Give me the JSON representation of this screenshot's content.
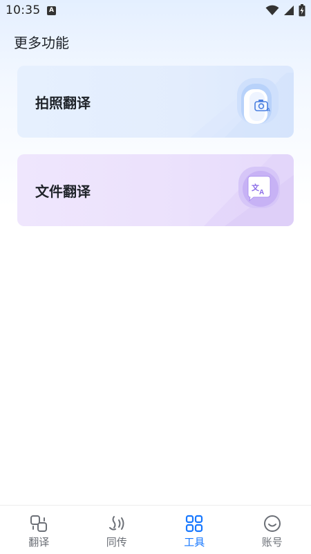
{
  "status_bar": {
    "time": "10:35",
    "notification_glyph": "A",
    "icons": [
      "wifi-icon",
      "cell-signal-icon",
      "battery-charging-icon"
    ]
  },
  "header": {
    "title": "更多功能"
  },
  "cards": [
    {
      "label": "拍照翻译",
      "icon": "camera-translate-icon",
      "color": "#dbe8fd"
    },
    {
      "label": "文件翻译",
      "icon": "document-translate-icon",
      "color": "#e6dafb"
    }
  ],
  "bottom_nav": {
    "items": [
      {
        "label": "翻译",
        "icon": "translate-tab-icon",
        "active": false
      },
      {
        "label": "同传",
        "icon": "interpret-tab-icon",
        "active": false
      },
      {
        "label": "工具",
        "icon": "tools-tab-icon",
        "active": true
      },
      {
        "label": "账号",
        "icon": "account-tab-icon",
        "active": false
      }
    ],
    "active_color": "#1677ff",
    "inactive_color": "#6b6f76"
  }
}
